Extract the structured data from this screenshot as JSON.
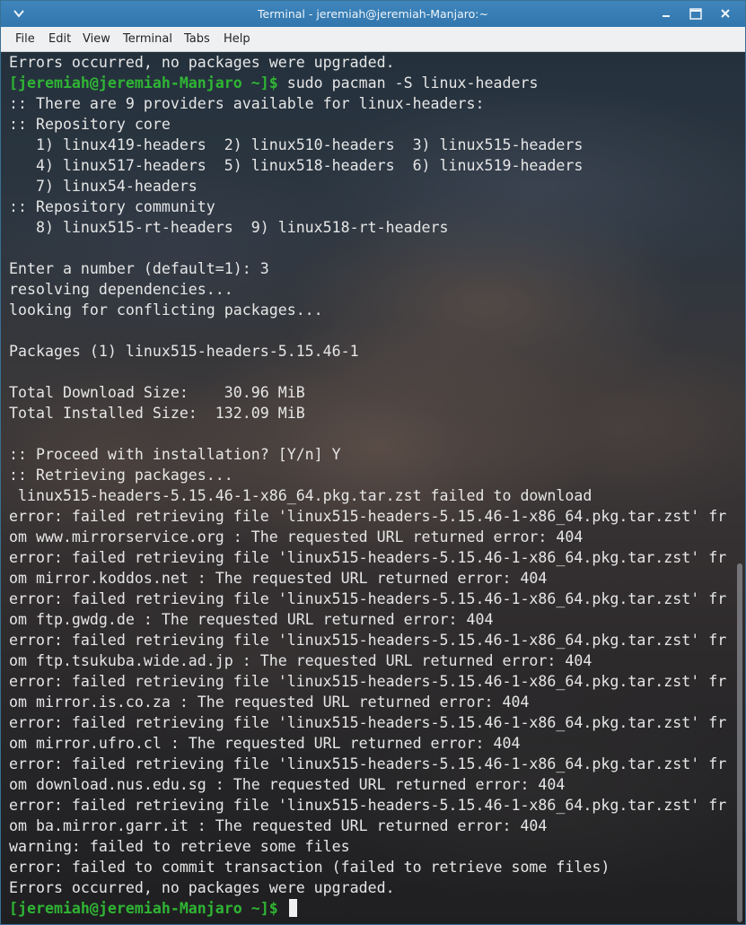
{
  "window": {
    "title": "Terminal - jeremiah@jeremiah-Manjaro:~"
  },
  "menubar": {
    "items": [
      "File",
      "Edit",
      "View",
      "Terminal",
      "Tabs",
      "Help"
    ]
  },
  "terminal": {
    "lines": [
      "Errors occurred, no packages were upgraded.",
      "$PROMPT$sudo pacman -S linux-headers",
      ":: There are 9 providers available for linux-headers:",
      ":: Repository core",
      "   1) linux419-headers  2) linux510-headers  3) linux515-headers",
      "   4) linux517-headers  5) linux518-headers  6) linux519-headers",
      "   7) linux54-headers",
      ":: Repository community",
      "   8) linux515-rt-headers  9) linux518-rt-headers",
      "",
      "Enter a number (default=1): 3",
      "resolving dependencies...",
      "looking for conflicting packages...",
      "",
      "Packages (1) linux515-headers-5.15.46-1",
      "",
      "Total Download Size:    30.96 MiB",
      "Total Installed Size:  132.09 MiB",
      "",
      ":: Proceed with installation? [Y/n] Y",
      ":: Retrieving packages...",
      " linux515-headers-5.15.46-1-x86_64.pkg.tar.zst failed to download",
      "error: failed retrieving file 'linux515-headers-5.15.46-1-x86_64.pkg.tar.zst' fr",
      "om www.mirrorservice.org : The requested URL returned error: 404",
      "error: failed retrieving file 'linux515-headers-5.15.46-1-x86_64.pkg.tar.zst' fr",
      "om mirror.koddos.net : The requested URL returned error: 404",
      "error: failed retrieving file 'linux515-headers-5.15.46-1-x86_64.pkg.tar.zst' fr",
      "om ftp.gwdg.de : The requested URL returned error: 404",
      "error: failed retrieving file 'linux515-headers-5.15.46-1-x86_64.pkg.tar.zst' fr",
      "om ftp.tsukuba.wide.ad.jp : The requested URL returned error: 404",
      "error: failed retrieving file 'linux515-headers-5.15.46-1-x86_64.pkg.tar.zst' fr",
      "om mirror.is.co.za : The requested URL returned error: 404",
      "error: failed retrieving file 'linux515-headers-5.15.46-1-x86_64.pkg.tar.zst' fr",
      "om mirror.ufro.cl : The requested URL returned error: 404",
      "error: failed retrieving file 'linux515-headers-5.15.46-1-x86_64.pkg.tar.zst' fr",
      "om download.nus.edu.sg : The requested URL returned error: 404",
      "error: failed retrieving file 'linux515-headers-5.15.46-1-x86_64.pkg.tar.zst' fr",
      "om ba.mirror.garr.it : The requested URL returned error: 404",
      "warning: failed to retrieve some files",
      "error: failed to commit transaction (failed to retrieve some files)",
      "Errors occurred, no packages were upgraded.",
      "$PROMPT$"
    ],
    "prompt": "[jeremiah@jeremiah-Manjaro ~]$ ",
    "prompt_color": "#2fb534",
    "text_color": "#e6e6e6"
  },
  "icons": {
    "menu": "chevron-down-icon",
    "minimize": "minimize-icon",
    "maximize": "maximize-icon",
    "close": "close-icon"
  }
}
